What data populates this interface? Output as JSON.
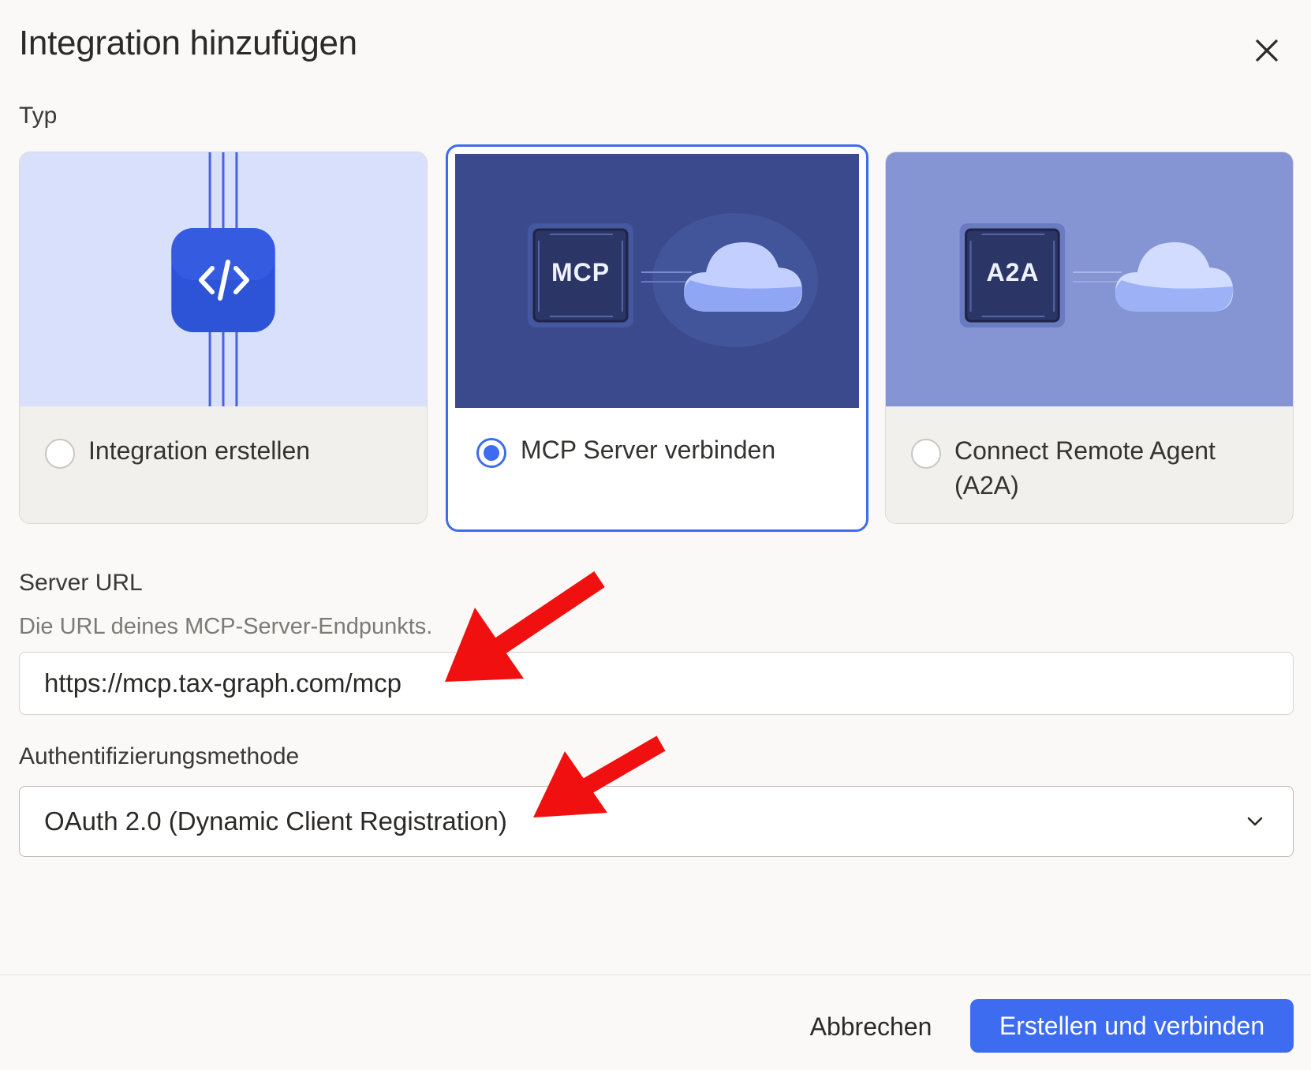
{
  "dialog": {
    "title": "Integration hinzufügen",
    "close_icon": "close-icon"
  },
  "type_section": {
    "label": "Typ",
    "cards": [
      {
        "label": "Integration erstellen",
        "selected": false,
        "icon": "code-icon"
      },
      {
        "label": "MCP Server verbinden",
        "selected": true,
        "icon": "chip-cloud-icon",
        "chip_text": "MCP"
      },
      {
        "label": "Connect Remote Agent (A2A)",
        "selected": false,
        "icon": "chip-cloud-icon",
        "chip_text": "A2A"
      }
    ]
  },
  "server_url": {
    "label": "Server URL",
    "hint": "Die URL deines MCP-Server-Endpunkts.",
    "value": "https://mcp.tax-graph.com/mcp"
  },
  "auth": {
    "label": "Authentifizierungsmethode",
    "selected": "OAuth 2.0 (Dynamic Client Registration)"
  },
  "footer": {
    "cancel_label": "Abbrechen",
    "submit_label": "Erstellen und verbinden"
  },
  "colors": {
    "accent": "#3d6cf0",
    "annotation_arrow": "#f01010",
    "card1_bg": "#d8e0fb",
    "card2_bg": "#3b4a8c",
    "card3_bg": "#8594d3"
  }
}
